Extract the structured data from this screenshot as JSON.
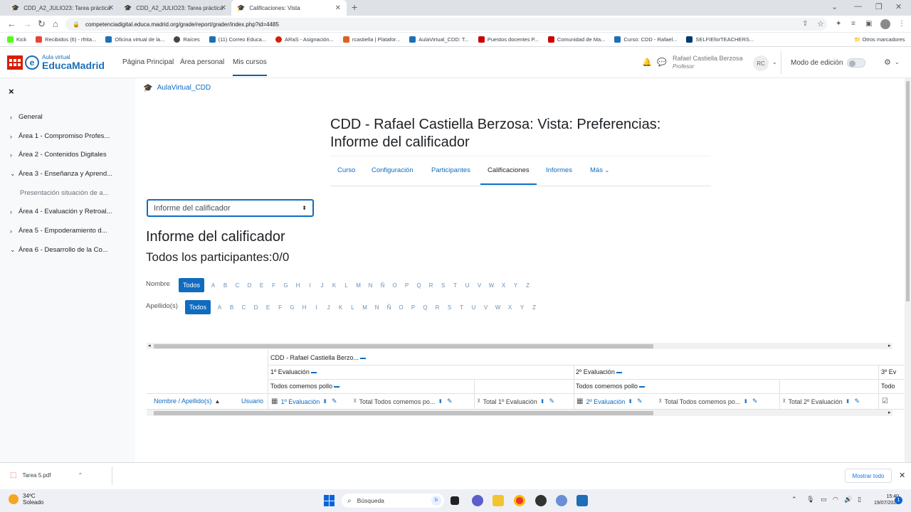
{
  "browser": {
    "tabs": [
      {
        "title": "CDD_A2_JULIO23: Tarea práctica",
        "active": false
      },
      {
        "title": "CDD_A2_JULIO23: Tarea práctica",
        "active": false
      },
      {
        "title": "Calificaciones: Vista",
        "active": true
      }
    ],
    "url": "competenciadigital.educa.madrid.org/grade/report/grader/index.php?id=4485",
    "bookmarks": [
      "Kick",
      "Recibidos (6) - rfrita...",
      "Oficina virtual de la...",
      "Raíces",
      "(11) Correo Educa...",
      "ARaS - Asignación...",
      "rcastiella | Platafor...",
      "AulaVirtual_CDD: T...",
      "Puestos docentes P...",
      "Comunidad de Ma...",
      "Curso: CDD - Rafael...",
      "SELFIEforTEACHERS..."
    ],
    "other_bookmarks": "Otros marcadores"
  },
  "navbar": {
    "logo_top": "Aula virtual",
    "logo_bottom": "EducaMadrid",
    "links": [
      "Página Principal",
      "Área personal",
      "Mis cursos"
    ],
    "user_name": "Rafael Castiella Berzosa",
    "user_role": "Profesor",
    "avatar_initials": "RC",
    "edit_mode_label": "Modo de edición"
  },
  "drawer": {
    "close": "×",
    "items": [
      {
        "label": "General",
        "expanded": false
      },
      {
        "label": "Área 1 - Compromiso Profes...",
        "expanded": false
      },
      {
        "label": "Área 2 - Contenidos Digitales",
        "expanded": false
      },
      {
        "label": "Área 3 - Enseñanza y Aprend...",
        "expanded": true
      },
      {
        "label": "Presentación situación de a...",
        "sub": true
      },
      {
        "label": "Área 4 - Evaluación y Retroal...",
        "expanded": false
      },
      {
        "label": "Área 5 - Empoderamiento d...",
        "expanded": false
      },
      {
        "label": "Área 6 - Desarrollo de la Co...",
        "expanded": true
      }
    ]
  },
  "page": {
    "breadcrumb": "AulaVirtual_CDD",
    "title_line1": "CDD - Rafael Castiella Berzosa: Vista: Preferencias:",
    "title_line2": "Informe del calificador",
    "secnav": [
      "Curso",
      "Configuración",
      "Participantes",
      "Calificaciones",
      "Informes",
      "Más"
    ],
    "secnav_active": "Calificaciones",
    "report_select": "Informe del calificador",
    "report_heading": "Informe del calificador",
    "participants": "Todos los participantes:0/0",
    "filter_first_label": "Nombre",
    "filter_last_label": "Apellido(s)",
    "filter_all": "Todos",
    "letters": [
      "A",
      "B",
      "C",
      "D",
      "E",
      "F",
      "G",
      "H",
      "I",
      "J",
      "K",
      "L",
      "M",
      "N",
      "Ñ",
      "O",
      "P",
      "Q",
      "R",
      "S",
      "T",
      "U",
      "V",
      "W",
      "X",
      "Y",
      "Z"
    ]
  },
  "grader": {
    "course_row": "CDD - Rafael Castiella Berzo...",
    "eval1": "1º Evaluación",
    "eval2": "2º Evaluación",
    "eval3": "3º Ev",
    "cat1": "Todos comemos pollo",
    "cat2": "Todos comemos pollo",
    "cat3": "Todo",
    "name_header": "Nombre / Apellido(s)",
    "user_header": "Usuario",
    "columns": [
      "1º Evaluación",
      "Total Todos comemos po...",
      "Total 1º Evaluación",
      "2º Evaluación",
      "Total Todos comemos po...",
      "Total 2º Evaluación"
    ]
  },
  "downloads": {
    "file": "Tarea 5.pdf",
    "show_all": "Mostrar todo"
  },
  "taskbar": {
    "temp": "34ºC",
    "weather": "Soleado",
    "search": "Búsqueda",
    "time": "15:40",
    "date": "19/07/2023"
  }
}
